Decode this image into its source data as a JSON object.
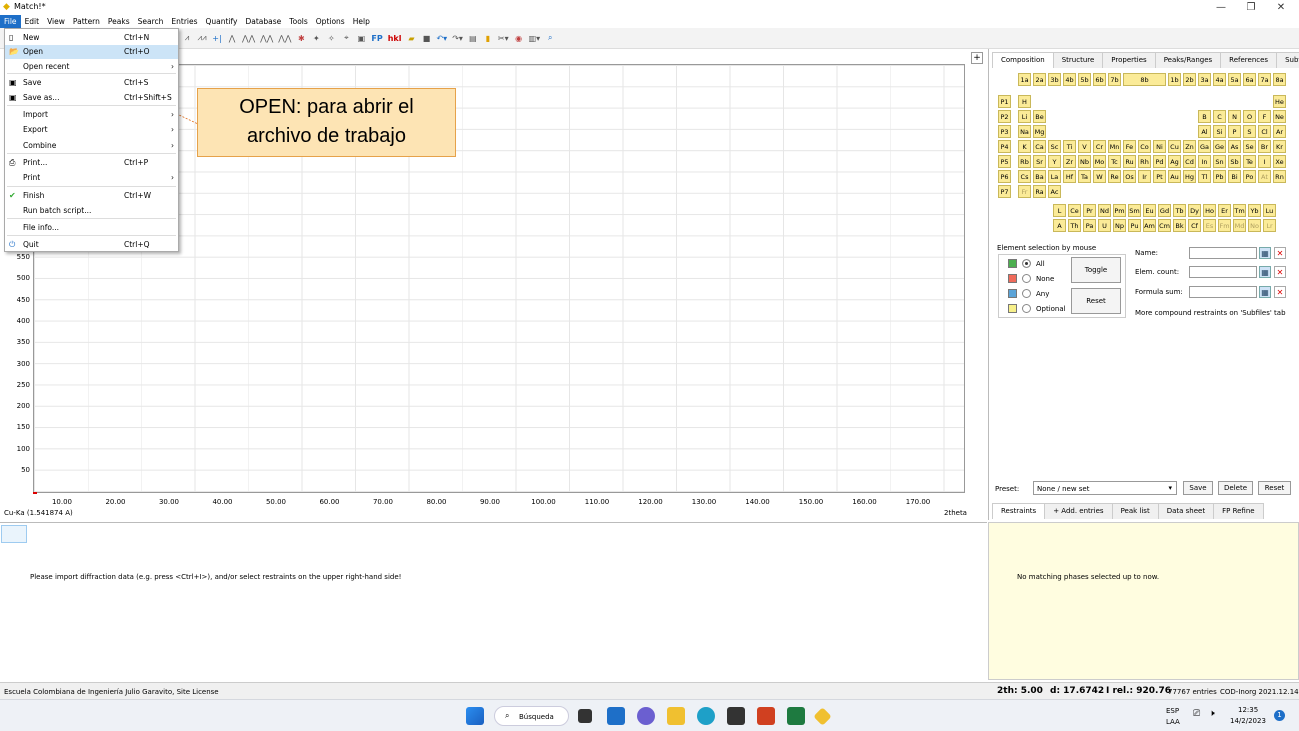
{
  "window": {
    "title": "Match!*"
  },
  "menu": [
    "File",
    "Edit",
    "View",
    "Pattern",
    "Peaks",
    "Search",
    "Entries",
    "Quantify",
    "Database",
    "Tools",
    "Options",
    "Help"
  ],
  "filemenu": [
    {
      "label": "New",
      "shortcut": "Ctrl+N",
      "icon": "new-file-icon"
    },
    {
      "label": "Open",
      "shortcut": "Ctrl+O",
      "icon": "open-folder-icon"
    },
    {
      "label": "Open recent",
      "shortcut": "",
      "arrow": "›"
    },
    {
      "label": "Save",
      "shortcut": "Ctrl+S",
      "icon": "save-icon"
    },
    {
      "label": "Save as...",
      "shortcut": "Ctrl+Shift+S",
      "icon": "save-as-icon"
    },
    {
      "label": "Import",
      "shortcut": "",
      "arrow": "›"
    },
    {
      "label": "Export",
      "shortcut": "",
      "arrow": "›"
    },
    {
      "label": "Combine",
      "shortcut": "",
      "arrow": "›"
    },
    {
      "label": "Print...",
      "shortcut": "Ctrl+P",
      "icon": "printer-icon"
    },
    {
      "label": "Print",
      "shortcut": "",
      "arrow": "›"
    },
    {
      "label": "Finish",
      "shortcut": "Ctrl+W",
      "icon": "checkmark-icon"
    },
    {
      "label": "Run batch script...",
      "shortcut": ""
    },
    {
      "label": "File info...",
      "shortcut": ""
    },
    {
      "label": "Quit",
      "shortcut": "Ctrl+Q",
      "icon": "quit-icon"
    }
  ],
  "callout": {
    "line1": "OPEN: para abrir el",
    "line2": "archivo de trabajo"
  },
  "plot": {
    "yticks": [
      "550",
      "500",
      "450",
      "400",
      "350",
      "300",
      "250",
      "200",
      "150",
      "100",
      "50"
    ],
    "xticks": [
      "10.00",
      "20.00",
      "30.00",
      "40.00",
      "50.00",
      "60.00",
      "70.00",
      "80.00",
      "90.00",
      "100.00",
      "110.00",
      "120.00",
      "130.00",
      "140.00",
      "150.00",
      "160.00",
      "170.00"
    ],
    "wavelength": "Cu-Ka (1.541874 A)",
    "xunit": "2theta"
  },
  "lower": {
    "message": "Please import diffraction data (e.g. press <Ctrl+I>), and/or select restraints on the upper right-hand side!"
  },
  "lowerRight": {
    "message": "No matching phases selected up to now."
  },
  "rightTabs": [
    "Composition",
    "Structure",
    "Properties",
    "Peaks/Ranges",
    "References",
    "Subfiles"
  ],
  "groups": [
    "1a",
    "2a",
    "3b",
    "4b",
    "5b",
    "6b",
    "7b",
    "8b",
    "1b",
    "2b",
    "3a",
    "4a",
    "5a",
    "6a",
    "7a",
    "8a"
  ],
  "periods": [
    "P1",
    "P2",
    "P3",
    "P4",
    "P5",
    "P6",
    "P7"
  ],
  "elements": {
    "r1": [
      "H",
      "He"
    ],
    "r2": [
      "Li",
      "Be",
      "B",
      "C",
      "N",
      "O",
      "F",
      "Ne"
    ],
    "r3": [
      "Na",
      "Mg",
      "Al",
      "Si",
      "P",
      "S",
      "Cl",
      "Ar"
    ],
    "r4": [
      "K",
      "Ca",
      "Sc",
      "Ti",
      "V",
      "Cr",
      "Mn",
      "Fe",
      "Co",
      "Ni",
      "Cu",
      "Zn",
      "Ga",
      "Ge",
      "As",
      "Se",
      "Br",
      "Kr"
    ],
    "r5": [
      "Rb",
      "Sr",
      "Y",
      "Zr",
      "Nb",
      "Mo",
      "Tc",
      "Ru",
      "Rh",
      "Pd",
      "Ag",
      "Cd",
      "In",
      "Sn",
      "Sb",
      "Te",
      "I",
      "Xe"
    ],
    "r6": [
      "Cs",
      "Ba",
      "La",
      "Hf",
      "Ta",
      "W",
      "Re",
      "Os",
      "Ir",
      "Pt",
      "Au",
      "Hg",
      "Tl",
      "Pb",
      "Bi",
      "Po",
      "At",
      "Rn"
    ],
    "r7": [
      "Fr",
      "Ra",
      "Ac"
    ],
    "lan": [
      "L",
      "Ce",
      "Pr",
      "Nd",
      "Pm",
      "Sm",
      "Eu",
      "Gd",
      "Tb",
      "Dy",
      "Ho",
      "Er",
      "Tm",
      "Yb",
      "Lu"
    ],
    "act": [
      "A",
      "Th",
      "Pa",
      "U",
      "Np",
      "Pu",
      "Am",
      "Cm",
      "Bk",
      "Cf",
      "Es",
      "Fm",
      "Md",
      "No",
      "Lr"
    ]
  },
  "selection": {
    "title": "Element selection by mouse",
    "options": [
      "All",
      "None",
      "Any",
      "Optional"
    ],
    "toggle": "Toggle",
    "reset": "Reset"
  },
  "restraints": {
    "name": "Name:",
    "count": "Elem. count:",
    "formula": "Formula sum:",
    "note": "More compound restraints on 'Subfiles' tab"
  },
  "preset": {
    "label": "Preset:",
    "value": "None / new set",
    "save": "Save",
    "delete": "Delete",
    "reset": "Reset"
  },
  "bottomTabs": [
    "Restraints",
    "+ Add. entries",
    "Peak list",
    "Data sheet",
    "FP Refine"
  ],
  "status": {
    "license": "Escuela Colombiana de Ingeniería Julio Garavito, Site License",
    "twotheta": "2th:  5.00",
    "d": "d: 17.6742",
    "irel": "I rel.: 920.76",
    "entries": "77767 entries",
    "db": "COD-Inorg 2021.12.14"
  },
  "taskbar": {
    "search": "Búsqueda",
    "lang1": "ESP",
    "lang2": "LAA",
    "time": "12:35",
    "date": "14/2/2023",
    "badge": "1"
  }
}
